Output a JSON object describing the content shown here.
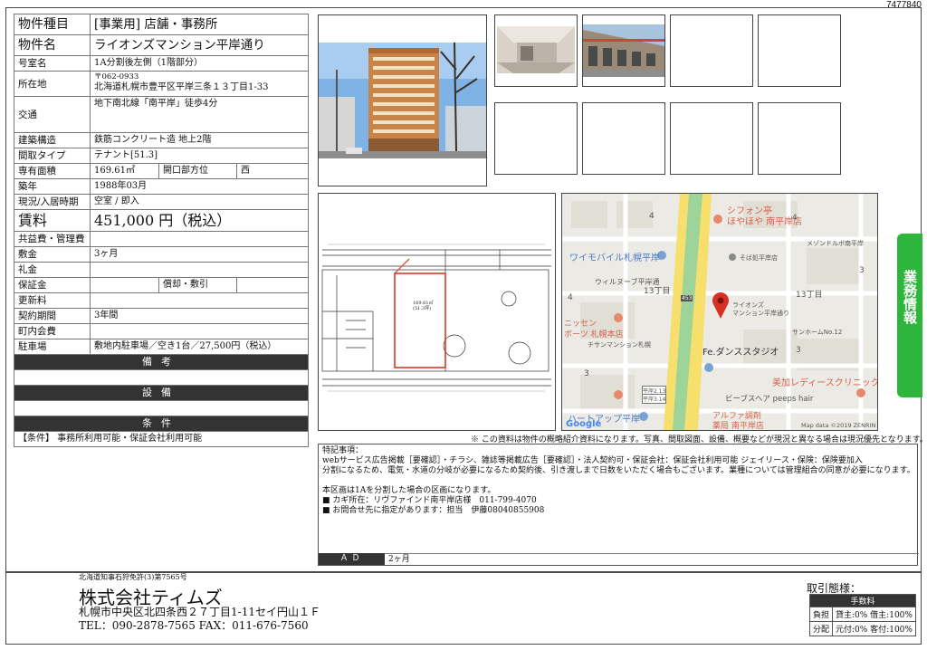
{
  "doc_id": "7477840",
  "property": {
    "type_label": "物件種目",
    "type_value": "[事業用] 店舗・事務所",
    "name_label": "物件名",
    "name_value": "ライオンズマンション平岸通り",
    "room_label": "号室名",
    "room_value": "1A分割後左側（1階部分）",
    "address_label": "所在地",
    "postal": "〒062-0933",
    "address_value": "北海道札幌市豊平区平岸三条１３丁目1-33",
    "access_label": "交通",
    "access_value": "地下南北線「南平岸」徒歩4分",
    "structure_label": "建築構造",
    "structure_value": "鉄筋コンクリート造 地上2階",
    "layout_label": "間取タイプ",
    "layout_value": "テナント[51.3]",
    "area_label": "専有面積",
    "area_value": "169.61㎡",
    "opening_label": "開口部方位",
    "opening_value": "西",
    "built_label": "築年",
    "built_value": "1988年03月",
    "status_label": "現況/入居時期",
    "status_value": "空室 / 即入",
    "rent_label": "賃料",
    "rent_value": "451,000 円（税込）",
    "fee_label": "共益費・管理費",
    "fee_value": "",
    "deposit_label": "敷金",
    "deposit_value": "3ヶ月",
    "key_money_label": "礼金",
    "key_money_value": "",
    "guarantee_label": "保証金",
    "guarantee_value": "",
    "amort_label": "償却・敷引",
    "amort_value": "",
    "renewal_label": "更新料",
    "renewal_value": "",
    "term_label": "契約期間",
    "term_value": "3年間",
    "town_fee_label": "町内会費",
    "town_fee_value": "",
    "parking_label": "駐車場",
    "parking_value": "敷地内駐車場／空き1台／27,500円（税込）",
    "bikou_header": "備考",
    "setsubi_header": "設備",
    "joken_header": "条件",
    "joken_value": "【条件】 事務所利用可能・保証会社利用可能"
  },
  "plan": {
    "area_label": "169.61㎡",
    "area_sub": "(51.3坪)"
  },
  "map": {
    "labels": [
      "シフォン亭",
      "ほやほや 南平岸店",
      "そば処平岸店",
      "メゾンドルボ南平岸",
      "ワイモバイル札幌平岸",
      "ウィルヌーブ平岸通",
      "13丁目",
      "13丁目",
      "ライオンズ",
      "マンション平岸通り",
      "ニッセン",
      "ボーツ 札幌本店",
      "チサンマンション札幌",
      "Fe.ダンススタジオ",
      "サンホームNo.12",
      "美加レディースクリニック",
      "ビーブスヘア peeps hair",
      "ハートアップ平岸",
      "アルファ調剤",
      "薬局 南平岸店",
      "Google",
      "Map data ©2019 ZENRIN",
      "453",
      "4",
      "4",
      "3",
      "3",
      "4",
      "3",
      "平岸2.13",
      "平岸3.14"
    ]
  },
  "side_tab": "業務情報",
  "notice": "※ この資料は物件の概略紹介資料になります。写真、間取図面、設備、概要などが現況と異なる場合は現況優先となります。",
  "remarks": {
    "text": "特記事項：\nwebサービス広告掲載［要確認］・チラシ、雑誌等掲載広告［要確認］・法人契約可・保証会社：保証会社利用可能 ジェイリース・保険：保険要加入\n分割になるため、電気・水道の分岐が必要になるため契約後、引き渡しまで日数をいただく場合もございます。業種については管理組合の同意が必要になります。\n\n本区画は1Aを分割した場合の区画になります。\n■ カギ所在：リヴファインド南平岸店様　011-799-4070\n■ お問合せ先に指定があります：担当　伊藤08040855908",
    "ad_label": "ＡＤ",
    "ad_value": "2ヶ月"
  },
  "footer": {
    "license": "北海道知事石狩免許(3)第7565号",
    "company": "株式会社ティムズ",
    "address": "札幌市中央区北四条西２７丁目1-11セイ円山１Ｆ",
    "phones": "TEL：090-2878-7565 FAX：011-676-7560",
    "torihiki_title": "取引態様：",
    "fee_header": "手数料",
    "futan_label": "負担",
    "futan_value": "貸主:0% 借主:100%",
    "bunpai_label": "分配",
    "bunpai_value": "元付:0% 客付:100%"
  }
}
